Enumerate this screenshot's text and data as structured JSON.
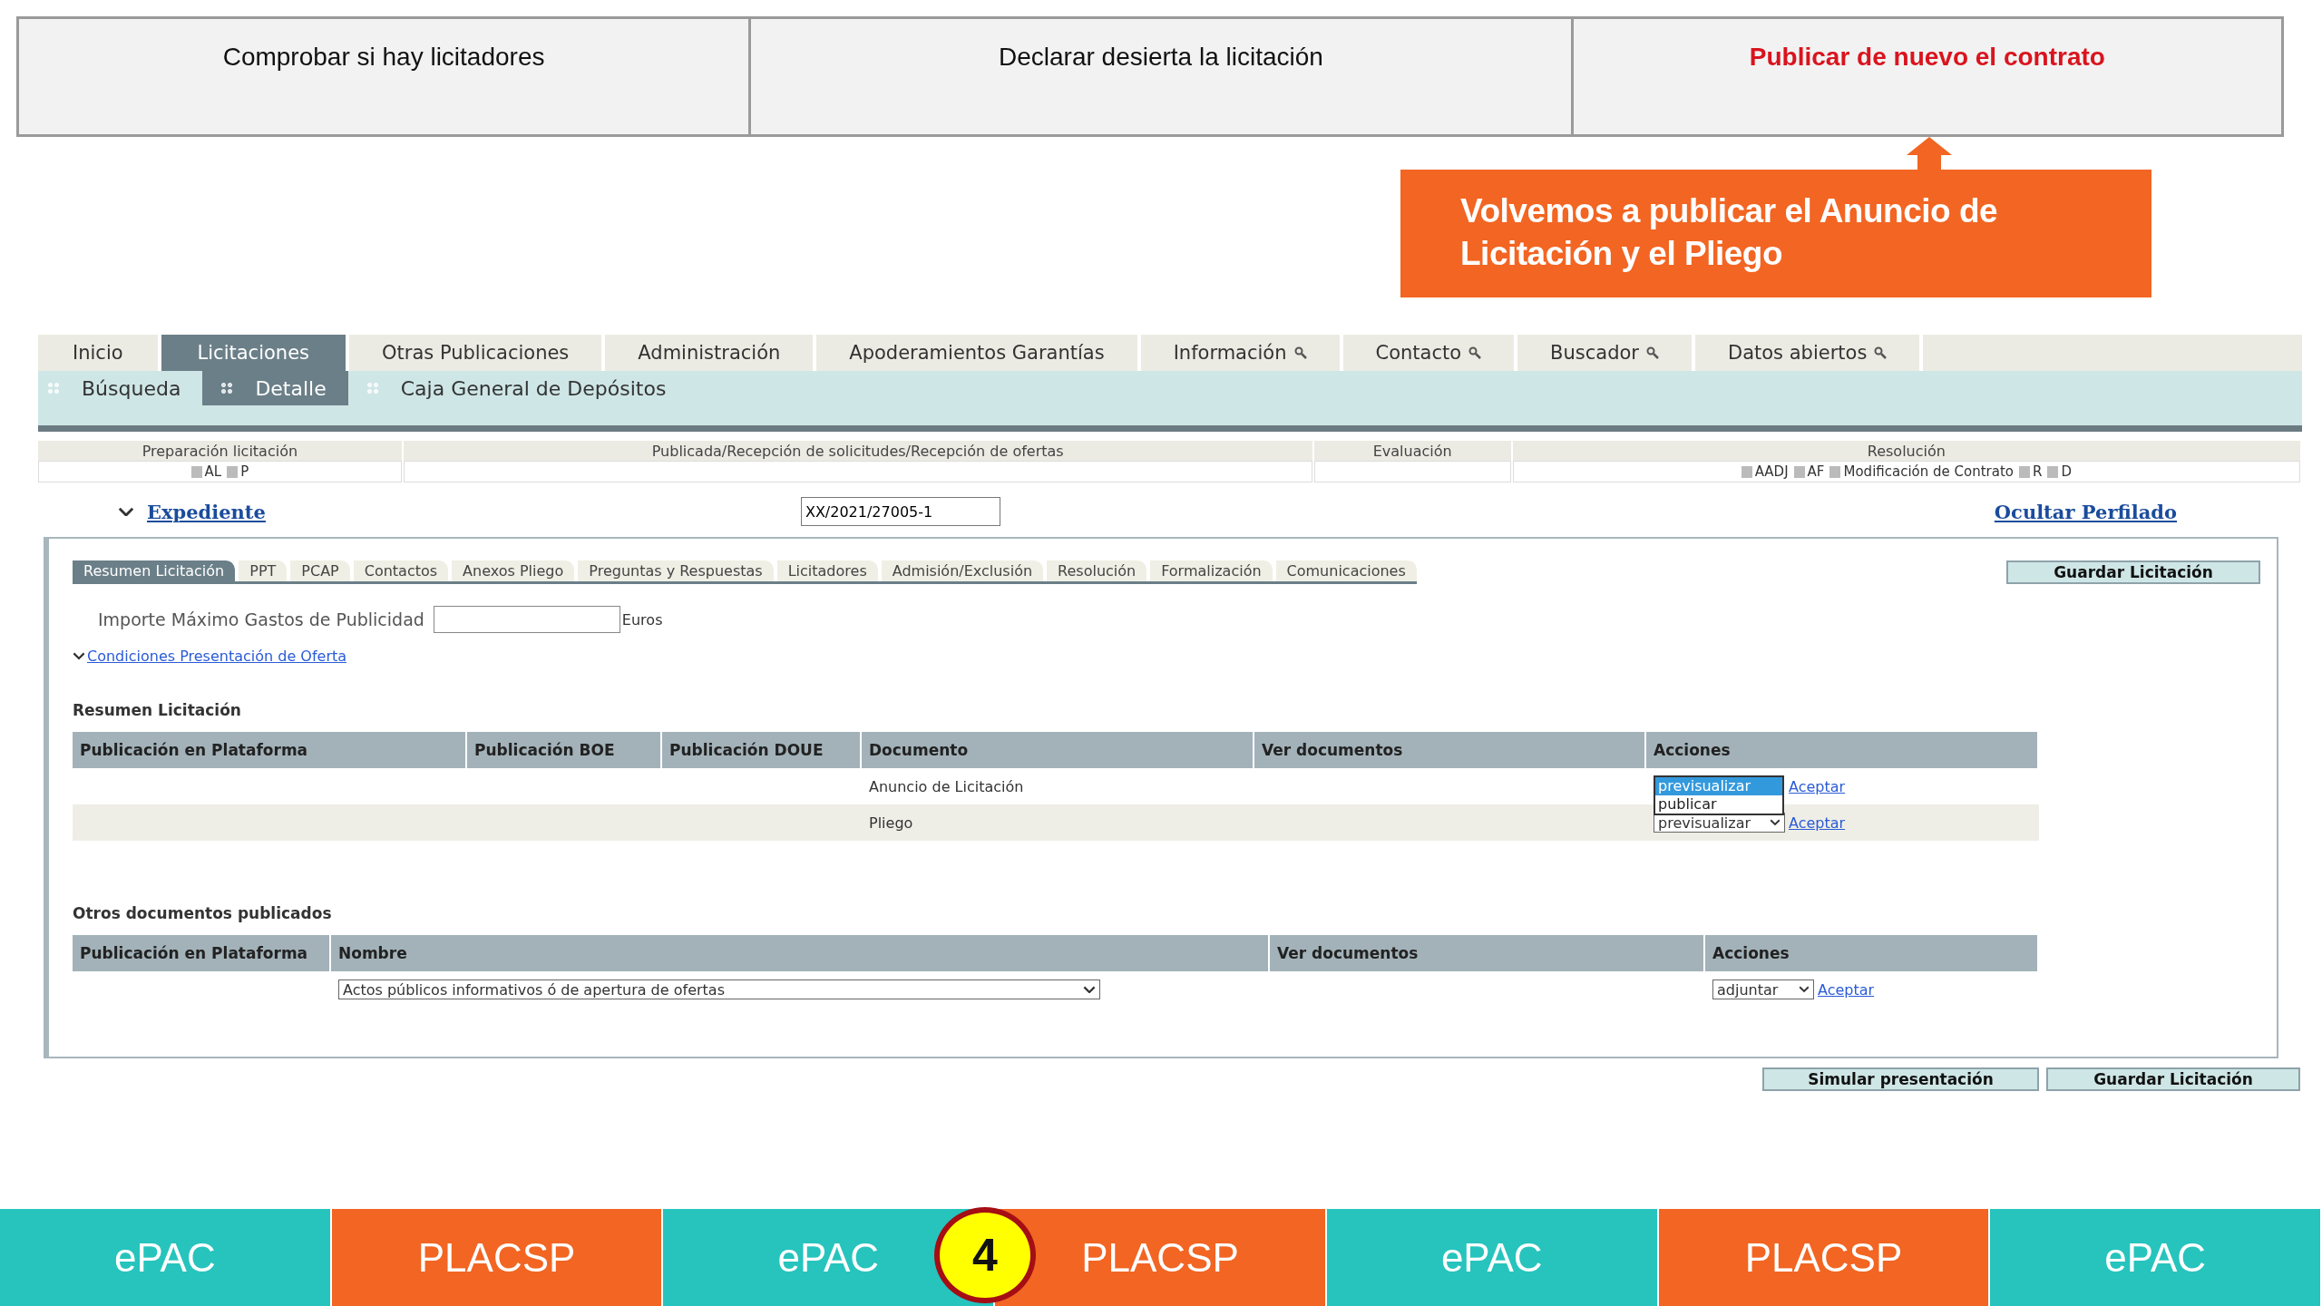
{
  "steps": [
    {
      "label": "Comprobar si hay licitadores",
      "highlighted": false
    },
    {
      "label": "Declarar desierta la licitación",
      "highlighted": false
    },
    {
      "label": "Publicar de nuevo el contrato",
      "highlighted": true
    }
  ],
  "callout": {
    "text": "Volvemos a publicar el Anuncio de Licitación y el Pliego"
  },
  "nav": [
    {
      "label": "Inicio",
      "selected": false,
      "search": false
    },
    {
      "label": "Licitaciones",
      "selected": true,
      "search": false
    },
    {
      "label": "Otras Publicaciones",
      "selected": false,
      "search": false
    },
    {
      "label": "Administración",
      "selected": false,
      "search": false
    },
    {
      "label": "Apoderamientos Garantías",
      "selected": false,
      "search": false
    },
    {
      "label": "Información",
      "selected": false,
      "search": true
    },
    {
      "label": "Contacto",
      "selected": false,
      "search": true
    },
    {
      "label": "Buscador",
      "selected": false,
      "search": true
    },
    {
      "label": "Datos abiertos",
      "selected": false,
      "search": true
    }
  ],
  "subnav": [
    {
      "label": "Búsqueda",
      "selected": false
    },
    {
      "label": "Detalle",
      "selected": true
    },
    {
      "label": "Caja General de Depósitos",
      "selected": false
    }
  ],
  "phases": [
    {
      "title": "Preparación licitación",
      "markers": [
        "AL",
        "P"
      ]
    },
    {
      "title": "Publicada/Recepción de solicitudes/Recepción de ofertas"
    },
    {
      "title": "Evaluación"
    },
    {
      "title": "Resolución",
      "markers": [
        "AADJ",
        "AF",
        "Modificación de Contrato",
        "R",
        "D"
      ]
    }
  ],
  "expediente": {
    "label": "Expediente",
    "value": "XX/2021/27005-1",
    "hide_link": "Ocultar Perfilado"
  },
  "tabs": [
    {
      "label": "Resumen Licitación",
      "selected": true
    },
    {
      "label": "PPT",
      "selected": false
    },
    {
      "label": "PCAP",
      "selected": false
    },
    {
      "label": "Contactos",
      "selected": false
    },
    {
      "label": "Anexos Pliego",
      "selected": false
    },
    {
      "label": "Preguntas y Respuestas",
      "selected": false
    },
    {
      "label": "Licitadores",
      "selected": false
    },
    {
      "label": "Admisión/Exclusión",
      "selected": false
    },
    {
      "label": "Resolución",
      "selected": false
    },
    {
      "label": "Formalización",
      "selected": false
    },
    {
      "label": "Comunicaciones",
      "selected": false
    }
  ],
  "save_button": "Guardar Licitación",
  "publicity": {
    "label": "Importe Máximo Gastos de Publicidad",
    "unit": "Euros"
  },
  "conditions_link": "Condiciones Presentación de Oferta",
  "summary": {
    "title": "Resumen Licitación",
    "columns": [
      "Publicación en Plataforma",
      "Publicación BOE",
      "Publicación DOUE",
      "Documento",
      "Ver documentos",
      "Acciones"
    ],
    "rows": [
      {
        "document": "Anuncio de Licitación",
        "action": {
          "kind": "listbox",
          "options": [
            {
              "label": "previsualizar",
              "selected": true
            },
            {
              "label": "publicar",
              "selected": false
            }
          ]
        },
        "link": "Aceptar"
      },
      {
        "document": "Pliego",
        "action": {
          "kind": "select",
          "value": "previsualizar"
        },
        "link": "Aceptar"
      }
    ]
  },
  "others": {
    "title": "Otros documentos publicados",
    "columns": [
      "Publicación en Plataforma",
      "Nombre",
      "Ver documentos",
      "Acciones"
    ],
    "rows": [
      {
        "name": "Actos públicos informativos ó de apertura de ofertas",
        "action": "adjuntar",
        "link": "Aceptar"
      }
    ]
  },
  "bottom_buttons": [
    "Simular presentación",
    "Guardar Licitación"
  ],
  "footer": [
    {
      "label": "ePAC",
      "color": "#26c4bd"
    },
    {
      "label": "PLACSP",
      "color": "#f26522"
    },
    {
      "label": "ePAC",
      "color": "#26c4bd"
    },
    {
      "label": "PLACSP",
      "color": "#f26522"
    },
    {
      "label": "ePAC",
      "color": "#26c4bd"
    },
    {
      "label": "PLACSP",
      "color": "#f26522"
    },
    {
      "label": "ePAC",
      "color": "#26c4bd"
    }
  ],
  "step_badge": "4"
}
